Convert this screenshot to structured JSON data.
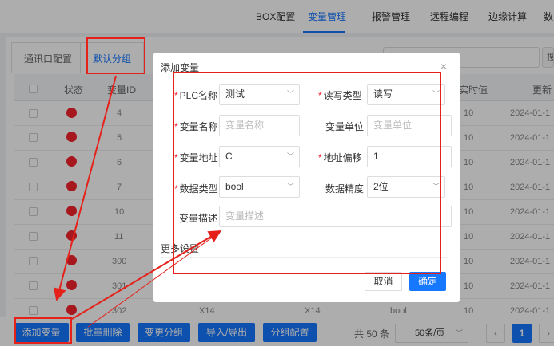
{
  "topnav": {
    "tabs": [
      {
        "label": "BOX配置"
      },
      {
        "label": "变量管理"
      },
      {
        "label": "报警管理"
      },
      {
        "label": "远程编程"
      },
      {
        "label": "边缘计算"
      },
      {
        "label": "数"
      }
    ],
    "active_tab": "变量管理"
  },
  "subtabs": {
    "items": [
      "通讯口配置",
      "默认分组"
    ],
    "active": "默认分组"
  },
  "search": {
    "button": "搜"
  },
  "table": {
    "columns": [
      "状态",
      "变量ID",
      "实时值",
      "更新"
    ],
    "rows": [
      {
        "id": "4",
        "value": "10",
        "time": "2024-01-1"
      },
      {
        "id": "5",
        "value": "10",
        "time": "2024-01-1"
      },
      {
        "id": "6",
        "value": "10",
        "time": "2024-01-1"
      },
      {
        "id": "7",
        "value": "10",
        "time": "2024-01-1"
      },
      {
        "id": "10",
        "value": "10",
        "time": "2024-01-1"
      },
      {
        "id": "11",
        "value": "10",
        "time": "2024-01-1"
      },
      {
        "id": "300",
        "value": "10",
        "time": "2024-01-1"
      },
      {
        "id": "301",
        "value": "10",
        "time": "2024-01-1"
      },
      {
        "id": "302",
        "value": "10",
        "time": "2024-01-1",
        "addr": "X14",
        "addr2": "X14",
        "type": "bool"
      }
    ]
  },
  "modal": {
    "title": "添加变量",
    "close": "×",
    "fields": {
      "plc_name": {
        "label": "PLC名称",
        "value": "测试"
      },
      "rw_type": {
        "label": "读写类型",
        "value": "读写"
      },
      "var_name": {
        "label": "变量名称",
        "placeholder": "变量名称"
      },
      "var_unit": {
        "label": "变量单位",
        "placeholder": "变量单位"
      },
      "var_addr": {
        "label": "变量地址",
        "value": "C"
      },
      "addr_offset": {
        "label": "地址偏移",
        "value": "1"
      },
      "data_type": {
        "label": "数据类型",
        "value": "bool"
      },
      "precision": {
        "label": "数据精度",
        "value": "2位"
      },
      "var_desc": {
        "label": "变量描述",
        "placeholder": "变量描述"
      }
    },
    "more_settings": "更多设置",
    "cancel": "取消",
    "ok": "确定"
  },
  "bottombar": {
    "buttons": [
      "添加变量",
      "批量删除",
      "变更分组",
      "导入/导出",
      "分组配置"
    ],
    "total": "共 50 条",
    "page_size": "50条/页",
    "current_page": "1"
  },
  "colors": {
    "accent": "#1677ff",
    "status_red": "#f5222d",
    "annotation_red": "#e5211a"
  },
  "icons": [
    "close-icon",
    "chevron-down-icon",
    "chevron-left-icon",
    "chevron-right-icon",
    "search-icon"
  ]
}
